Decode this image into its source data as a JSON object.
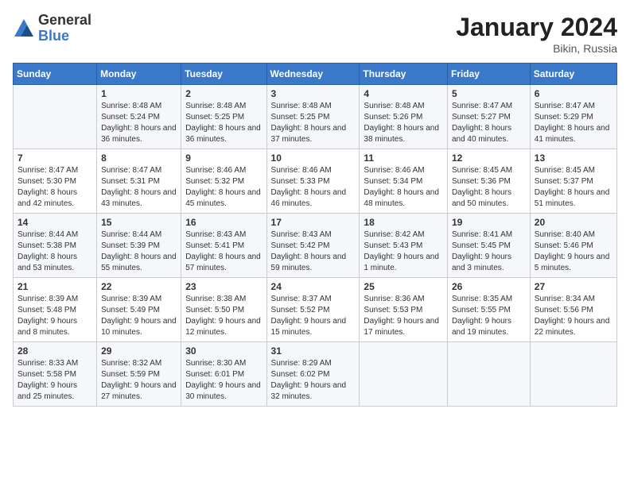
{
  "app": {
    "logo_general": "General",
    "logo_blue": "Blue"
  },
  "header": {
    "title": "January 2024",
    "location": "Bikin, Russia"
  },
  "columns": [
    "Sunday",
    "Monday",
    "Tuesday",
    "Wednesday",
    "Thursday",
    "Friday",
    "Saturday"
  ],
  "weeks": [
    [
      {
        "day": "",
        "sunrise": "",
        "sunset": "",
        "daylight": ""
      },
      {
        "day": "1",
        "sunrise": "Sunrise: 8:48 AM",
        "sunset": "Sunset: 5:24 PM",
        "daylight": "Daylight: 8 hours and 36 minutes."
      },
      {
        "day": "2",
        "sunrise": "Sunrise: 8:48 AM",
        "sunset": "Sunset: 5:25 PM",
        "daylight": "Daylight: 8 hours and 36 minutes."
      },
      {
        "day": "3",
        "sunrise": "Sunrise: 8:48 AM",
        "sunset": "Sunset: 5:25 PM",
        "daylight": "Daylight: 8 hours and 37 minutes."
      },
      {
        "day": "4",
        "sunrise": "Sunrise: 8:48 AM",
        "sunset": "Sunset: 5:26 PM",
        "daylight": "Daylight: 8 hours and 38 minutes."
      },
      {
        "day": "5",
        "sunrise": "Sunrise: 8:47 AM",
        "sunset": "Sunset: 5:27 PM",
        "daylight": "Daylight: 8 hours and 40 minutes."
      },
      {
        "day": "6",
        "sunrise": "Sunrise: 8:47 AM",
        "sunset": "Sunset: 5:29 PM",
        "daylight": "Daylight: 8 hours and 41 minutes."
      }
    ],
    [
      {
        "day": "7",
        "sunrise": "Sunrise: 8:47 AM",
        "sunset": "Sunset: 5:30 PM",
        "daylight": "Daylight: 8 hours and 42 minutes."
      },
      {
        "day": "8",
        "sunrise": "Sunrise: 8:47 AM",
        "sunset": "Sunset: 5:31 PM",
        "daylight": "Daylight: 8 hours and 43 minutes."
      },
      {
        "day": "9",
        "sunrise": "Sunrise: 8:46 AM",
        "sunset": "Sunset: 5:32 PM",
        "daylight": "Daylight: 8 hours and 45 minutes."
      },
      {
        "day": "10",
        "sunrise": "Sunrise: 8:46 AM",
        "sunset": "Sunset: 5:33 PM",
        "daylight": "Daylight: 8 hours and 46 minutes."
      },
      {
        "day": "11",
        "sunrise": "Sunrise: 8:46 AM",
        "sunset": "Sunset: 5:34 PM",
        "daylight": "Daylight: 8 hours and 48 minutes."
      },
      {
        "day": "12",
        "sunrise": "Sunrise: 8:45 AM",
        "sunset": "Sunset: 5:36 PM",
        "daylight": "Daylight: 8 hours and 50 minutes."
      },
      {
        "day": "13",
        "sunrise": "Sunrise: 8:45 AM",
        "sunset": "Sunset: 5:37 PM",
        "daylight": "Daylight: 8 hours and 51 minutes."
      }
    ],
    [
      {
        "day": "14",
        "sunrise": "Sunrise: 8:44 AM",
        "sunset": "Sunset: 5:38 PM",
        "daylight": "Daylight: 8 hours and 53 minutes."
      },
      {
        "day": "15",
        "sunrise": "Sunrise: 8:44 AM",
        "sunset": "Sunset: 5:39 PM",
        "daylight": "Daylight: 8 hours and 55 minutes."
      },
      {
        "day": "16",
        "sunrise": "Sunrise: 8:43 AM",
        "sunset": "Sunset: 5:41 PM",
        "daylight": "Daylight: 8 hours and 57 minutes."
      },
      {
        "day": "17",
        "sunrise": "Sunrise: 8:43 AM",
        "sunset": "Sunset: 5:42 PM",
        "daylight": "Daylight: 8 hours and 59 minutes."
      },
      {
        "day": "18",
        "sunrise": "Sunrise: 8:42 AM",
        "sunset": "Sunset: 5:43 PM",
        "daylight": "Daylight: 9 hours and 1 minute."
      },
      {
        "day": "19",
        "sunrise": "Sunrise: 8:41 AM",
        "sunset": "Sunset: 5:45 PM",
        "daylight": "Daylight: 9 hours and 3 minutes."
      },
      {
        "day": "20",
        "sunrise": "Sunrise: 8:40 AM",
        "sunset": "Sunset: 5:46 PM",
        "daylight": "Daylight: 9 hours and 5 minutes."
      }
    ],
    [
      {
        "day": "21",
        "sunrise": "Sunrise: 8:39 AM",
        "sunset": "Sunset: 5:48 PM",
        "daylight": "Daylight: 9 hours and 8 minutes."
      },
      {
        "day": "22",
        "sunrise": "Sunrise: 8:39 AM",
        "sunset": "Sunset: 5:49 PM",
        "daylight": "Daylight: 9 hours and 10 minutes."
      },
      {
        "day": "23",
        "sunrise": "Sunrise: 8:38 AM",
        "sunset": "Sunset: 5:50 PM",
        "daylight": "Daylight: 9 hours and 12 minutes."
      },
      {
        "day": "24",
        "sunrise": "Sunrise: 8:37 AM",
        "sunset": "Sunset: 5:52 PM",
        "daylight": "Daylight: 9 hours and 15 minutes."
      },
      {
        "day": "25",
        "sunrise": "Sunrise: 8:36 AM",
        "sunset": "Sunset: 5:53 PM",
        "daylight": "Daylight: 9 hours and 17 minutes."
      },
      {
        "day": "26",
        "sunrise": "Sunrise: 8:35 AM",
        "sunset": "Sunset: 5:55 PM",
        "daylight": "Daylight: 9 hours and 19 minutes."
      },
      {
        "day": "27",
        "sunrise": "Sunrise: 8:34 AM",
        "sunset": "Sunset: 5:56 PM",
        "daylight": "Daylight: 9 hours and 22 minutes."
      }
    ],
    [
      {
        "day": "28",
        "sunrise": "Sunrise: 8:33 AM",
        "sunset": "Sunset: 5:58 PM",
        "daylight": "Daylight: 9 hours and 25 minutes."
      },
      {
        "day": "29",
        "sunrise": "Sunrise: 8:32 AM",
        "sunset": "Sunset: 5:59 PM",
        "daylight": "Daylight: 9 hours and 27 minutes."
      },
      {
        "day": "30",
        "sunrise": "Sunrise: 8:30 AM",
        "sunset": "Sunset: 6:01 PM",
        "daylight": "Daylight: 9 hours and 30 minutes."
      },
      {
        "day": "31",
        "sunrise": "Sunrise: 8:29 AM",
        "sunset": "Sunset: 6:02 PM",
        "daylight": "Daylight: 9 hours and 32 minutes."
      },
      {
        "day": "",
        "sunrise": "",
        "sunset": "",
        "daylight": ""
      },
      {
        "day": "",
        "sunrise": "",
        "sunset": "",
        "daylight": ""
      },
      {
        "day": "",
        "sunrise": "",
        "sunset": "",
        "daylight": ""
      }
    ]
  ]
}
